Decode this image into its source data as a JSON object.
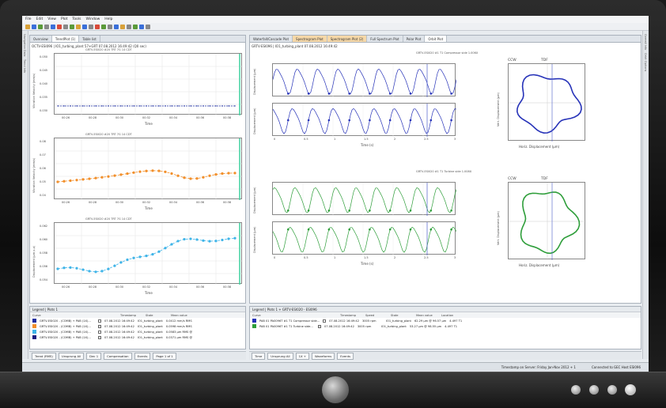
{
  "menu": [
    "File",
    "Edit",
    "View",
    "Plot",
    "Tools",
    "Window",
    "Help"
  ],
  "left_tabs": [
    {
      "label": "Overview"
    },
    {
      "label": "TrendPlot (1)",
      "active": true
    },
    {
      "label": "Table list"
    }
  ],
  "left_subheader": "OCTV-ESI096 | IO1_turbing_plant 57+GRT 07.08.2012 16:49:42 (Q0 sec)",
  "left_plots": [
    {
      "title": "GRTV-ESI020 #20 TRT 7G 14 CDT",
      "ylabel": "Vibration Velocity (mm/s)",
      "yticks": [
        "0.050",
        "0.045",
        "0.040",
        "0.035",
        "0.030"
      ],
      "color": "#1f2fa0",
      "x": "Time"
    },
    {
      "title": "GRTV-ESI020 #20 TRT 7G 14 CDT",
      "ylabel": "Vibration Velocity (mm/s)",
      "yticks": [
        "0.08",
        "0.07",
        "0.06",
        "0.05",
        "0.04"
      ],
      "color": "#f28f2a",
      "x": "Time"
    },
    {
      "title": "GRTV-ESI020 #20 TRT 7G 14 CDT",
      "ylabel": "Displacement (μm p-p)",
      "yticks": [
        "0.062",
        "0.060",
        "0.058",
        "0.056",
        "0.054"
      ],
      "color": "#3fb4e8",
      "x": "Time"
    }
  ],
  "left_xticks": [
    "00:26",
    "00:28",
    "00:30",
    "00:32",
    "00:34",
    "00:36",
    "00:38"
  ],
  "right_tabs": [
    {
      "label": "Waterfall/Cascade Plot"
    },
    {
      "label": "Spectrogram Plot",
      "orange": true
    },
    {
      "label": "Spectrogram Plot (2)",
      "orange": true
    },
    {
      "label": "Full Spectrum Plot"
    },
    {
      "label": "Polar Plot"
    },
    {
      "label": "Orbit Plot",
      "active": true
    }
  ],
  "right_subheader": "GRTV-ESI096 | IO1_turbing_plant 07.08.2012 16:49:42",
  "orbit_groups": [
    {
      "title": "GRTV-ESI020 #1 T1 Compressor side 1.006X",
      "color": "#2632b8",
      "cw": "CCW",
      "tdf": "TDF",
      "xlabel": "Time (s)",
      "ylabel": "Displacement (μm)",
      "orbit_x": "Horiz. Displacement (μm)",
      "orbit_y": "Vert. Displacement (μm)"
    },
    {
      "title": "GRTV-ESI020 #1 T1 Turbine side 1.008X",
      "color": "#2e9e3a",
      "cw": "CCW",
      "tdf": "TDF",
      "xlabel": "Time (s)",
      "ylabel": "Displacement (μm)",
      "orbit_x": "Horiz. Displacement (μm)",
      "orbit_y": "Vert. Displacement (μm)"
    }
  ],
  "wave_xticks": [
    "0",
    "0.5",
    "1",
    "1.5",
    "2",
    "2.5",
    "3"
  ],
  "left_legend": {
    "header": "Legend | Plots 1",
    "cols": [
      "Curve",
      "",
      "Timestamp",
      "State",
      "Mean value"
    ],
    "rows": [
      {
        "color": "#1f2fa0",
        "curve": "GRTV-ESI020 - (COMB) + PAB (1X)...",
        "ts": "07.08.2012 16:49:42",
        "state": "IO1_turbing_plant",
        "mean": "0.0412 mm/s RMS"
      },
      {
        "color": "#f28f2a",
        "curve": "GRTV-ESI020 - (COMB) + PAB (1X)...",
        "ts": "07.08.2012 16:49:42",
        "state": "IO1_turbing_plant",
        "mean": "0.0598 mm/s RMS"
      },
      {
        "color": "#3fb4e8",
        "curve": "GRTV-ESI020 - (COMB) + PAB (1X)...",
        "ts": "07.08.2012 16:49:42",
        "state": "IO1_turbing_plant",
        "mean": "0.0583 μm RMS @"
      },
      {
        "color": "#1a1a80",
        "curve": "GRTV-ESI020 - (COMB) + PAB (1X)...",
        "ts": "07.08.2012 16:49:42",
        "state": "IO1_turbing_plant",
        "mean": "0.0371 μm RMS @"
      }
    ]
  },
  "right_legend": {
    "header": "Legend | Plots 1 + GRTV-ESI020 - ESI096",
    "cols": [
      "Curve",
      "",
      "Timestamp",
      "Speed",
      "State",
      "Mean value",
      "Location"
    ],
    "rows": [
      {
        "color": "#2632b8",
        "curve": "PAB 01 PA0096T #1 T1 Compressor side...",
        "ts": "07.08.2012 16:49:42",
        "speed": "3005 rpm",
        "state": "IO1_turbing_plant",
        "mean": "62.29 μm @ 96.57 μm",
        "loc": "4.497 T1"
      },
      {
        "color": "#2e9e3a",
        "curve": "PAB 01 PA0096T #1 T1 Turbine side...",
        "ts": "07.08.2012 16:49:42",
        "speed": "3005 rpm",
        "state": "IO1_turbing_plant",
        "mean": "53.27 μm @ 98.55 μm",
        "loc": "4.497 T1"
      }
    ]
  },
  "left_bottom": [
    "Trend (RMS)",
    "Unsprung All",
    "Dec 1",
    "Compensation",
    "Events",
    "Page 1 of 1"
  ],
  "right_bottom": [
    "Time",
    "Unsprung All",
    "1X +",
    "Waveforms",
    "Events"
  ],
  "status": [
    "Timestamp on Server: Friday Jan-Nov 2012 + 1",
    "Connected to GEC Host ESI096"
  ],
  "left_sidebar": [
    "Navigation Data",
    "Trend Info"
  ],
  "right_sidebar": [
    "Overall Info",
    "Orbit Options"
  ]
}
